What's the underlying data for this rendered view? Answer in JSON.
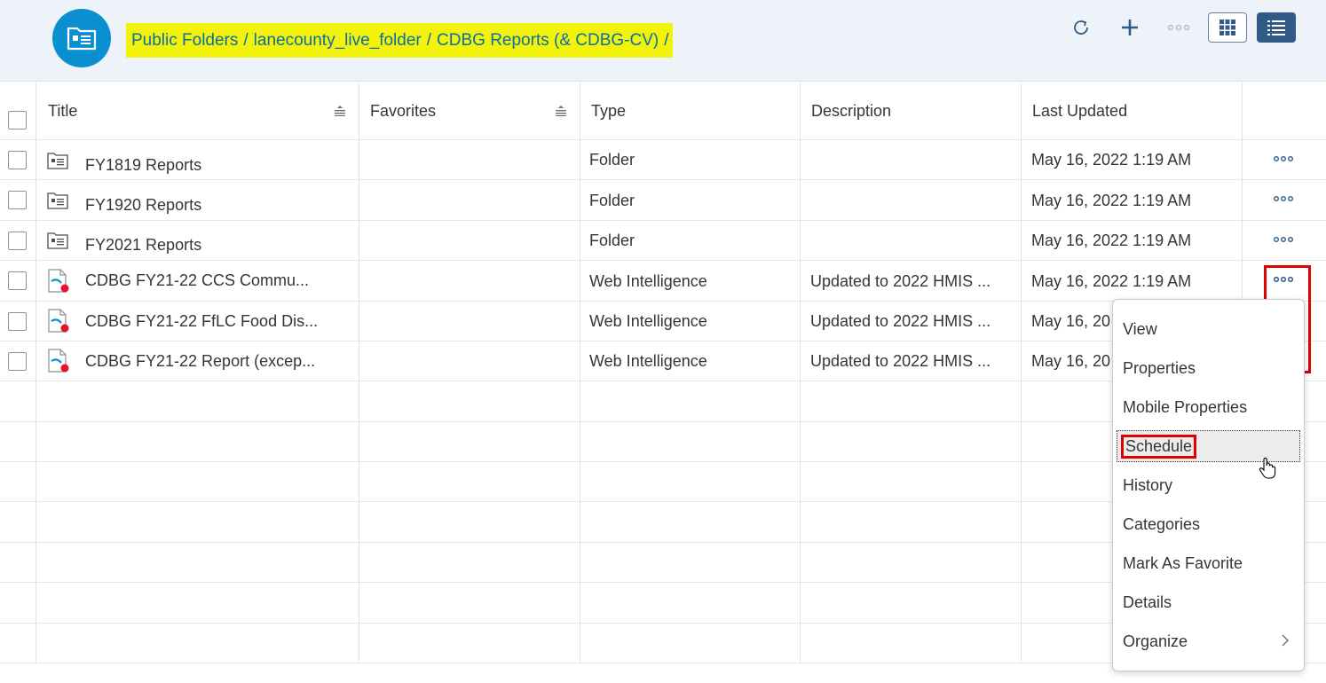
{
  "breadcrumb": {
    "items": [
      "Public Folders",
      "lanecounty_live_folder",
      "CDBG Reports (& CDBG-CV)"
    ],
    "separator": "/"
  },
  "toolbar": {
    "icons": [
      "refresh-icon",
      "add-icon",
      "more-icon",
      "grid-view-icon",
      "list-view-icon"
    ]
  },
  "table": {
    "columns": [
      "Title",
      "Favorites",
      "Type",
      "Description",
      "Last Updated"
    ],
    "rows": [
      {
        "title": "FY1819 Reports",
        "favorites": "",
        "type": "Folder",
        "description": "",
        "last_updated": "May 16, 2022 1:19 AM",
        "icon": "folder-icon"
      },
      {
        "title": "FY1920 Reports",
        "favorites": "",
        "type": "Folder",
        "description": "",
        "last_updated": "May 16, 2022 1:19 AM",
        "icon": "folder-icon"
      },
      {
        "title": "FY2021 Reports",
        "favorites": "",
        "type": "Folder",
        "description": "",
        "last_updated": "May 16, 2022 1:19 AM",
        "icon": "folder-icon"
      },
      {
        "title": "CDBG FY21-22 CCS Commu...",
        "favorites": "",
        "type": "Web Intelligence",
        "description": "Updated to 2022 HMIS ...",
        "last_updated": "May 16, 2022 1:19 AM",
        "icon": "webi-document-icon"
      },
      {
        "title": "CDBG FY21-22 FfLC Food Dis...",
        "favorites": "",
        "type": "Web Intelligence",
        "description": "Updated to 2022 HMIS ...",
        "last_updated": "May 16, 20",
        "icon": "webi-document-icon"
      },
      {
        "title": "CDBG FY21-22 Report (excep...",
        "favorites": "",
        "type": "Web Intelligence",
        "description": "Updated to 2022 HMIS ...",
        "last_updated": "May 16, 20",
        "icon": "webi-document-icon"
      }
    ]
  },
  "context_menu": {
    "items": [
      "View",
      "Properties",
      "Mobile Properties",
      "Schedule",
      "History",
      "Categories",
      "Mark As Favorite",
      "Details",
      "Organize"
    ],
    "selected": "Schedule"
  },
  "colors": {
    "header_bg": "#edf3f8",
    "avatar": "#0a8fd0",
    "breadcrumb_highlight": "#f2f20a",
    "link": "#0a6ea8",
    "list_button": "#2f5b86",
    "annotation_red": "#e00000"
  }
}
